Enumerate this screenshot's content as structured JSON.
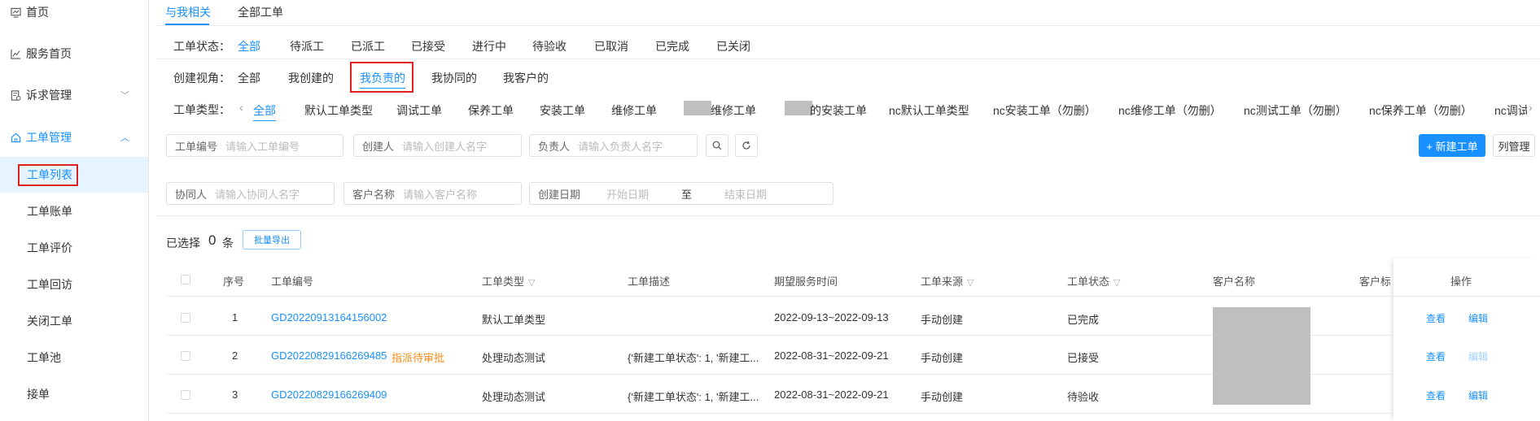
{
  "sidebar": {
    "items": [
      {
        "label": "首页",
        "icon": "dashboard-icon"
      },
      {
        "label": "服务首页",
        "icon": "chart-line-icon"
      },
      {
        "label": "诉求管理",
        "icon": "document-icon",
        "chevron": "﹀"
      },
      {
        "label": "工单管理",
        "icon": "home-icon",
        "chevron": "︿"
      }
    ],
    "sub_items": [
      "工单列表",
      "工单账单",
      "工单评价",
      "工单回访",
      "关闭工单",
      "工单池",
      "接单"
    ]
  },
  "tabs": [
    "与我相关",
    "全部工单"
  ],
  "filters": {
    "status": {
      "label": "工单状态：",
      "options": [
        "全部",
        "待派工",
        "已派工",
        "已接受",
        "进行中",
        "待验收",
        "已取消",
        "已完成",
        "已关闭"
      ]
    },
    "view": {
      "label": "创建视角：",
      "options": [
        "全部",
        "我创建的",
        "我负责的",
        "我协同的",
        "我客户的"
      ]
    },
    "type": {
      "label": "工单类型：",
      "prev": "‹",
      "next": "›",
      "options": [
        "全部",
        "默认工单类型",
        "调试工单",
        "保养工单",
        "安装工单",
        "维修工单",
        "维修工单",
        "的安装工单",
        "nc默认工单类型",
        "nc安装工单（勿删）",
        "nc维修工单（勿删）",
        "nc测试工单（勿删）",
        "nc保养工单（勿删）",
        "nc调试"
      ]
    }
  },
  "search": {
    "order_no": {
      "label": "工单编号",
      "placeholder": "请输入工单编号"
    },
    "creator": {
      "label": "创建人",
      "placeholder": "请输入创建人名字"
    },
    "owner": {
      "label": "负责人",
      "placeholder": "请输入负责人名字"
    },
    "collab": {
      "label": "协同人",
      "placeholder": "请输入协同人名字"
    },
    "customer": {
      "label": "客户名称",
      "placeholder": "请输入客户名称"
    },
    "date": {
      "label": "创建日期",
      "start": "开始日期",
      "to": "至",
      "end": "结束日期"
    }
  },
  "toolbar": {
    "new_order": "+ 新建工单",
    "columns": "列管理",
    "batch_export": "批量导出"
  },
  "selection": {
    "prefix": "已选择",
    "count": "0",
    "suffix": "条"
  },
  "table": {
    "headers": [
      "序号",
      "工单编号",
      "工单类型",
      "工单描述",
      "期望服务时间",
      "工单来源",
      "工单状态",
      "客户名称",
      "客户标签",
      "操作"
    ],
    "rows": [
      {
        "idx": "1",
        "no": "GD20220913164156002",
        "tag": "",
        "type": "默认工单类型",
        "desc": "",
        "time": "2022-09-13~2022-09-13",
        "source": "手动创建",
        "status": "已完成",
        "view": "查看",
        "edit": "编辑",
        "edit_disabled": false
      },
      {
        "idx": "2",
        "no": "GD20220829166269485",
        "tag": "指派待审批",
        "type": "处理动态测试",
        "desc": "{'新建工单状态': 1, '新建工...",
        "time": "2022-08-31~2022-09-21",
        "source": "手动创建",
        "status": "已接受",
        "view": "查看",
        "edit": "编辑",
        "edit_disabled": true
      },
      {
        "idx": "3",
        "no": "GD20220829166269409",
        "tag": "",
        "type": "处理动态测试",
        "desc": "{'新建工单状态': 1, '新建工...",
        "time": "2022-08-31~2022-09-21",
        "source": "手动创建",
        "status": "待验收",
        "view": "查看",
        "edit": "编辑",
        "edit_disabled": false
      }
    ]
  },
  "colors": {
    "accent": "#1890ff",
    "warning": "#fa8c16",
    "highlight": "#e02020"
  }
}
